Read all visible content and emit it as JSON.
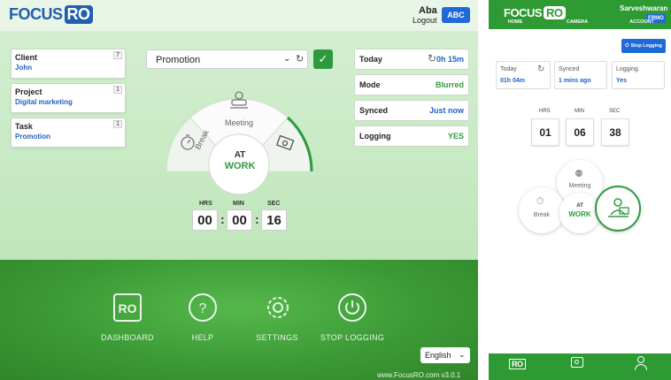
{
  "desktop": {
    "logo": {
      "text": "FOCUS",
      "suffix": "RO"
    },
    "header": {
      "user": "Aba",
      "logout": "Logout",
      "account_button": "ABC"
    },
    "fields": [
      {
        "label": "Client",
        "value": "John",
        "count": "7"
      },
      {
        "label": "Project",
        "value": "Digital marketing",
        "count": "1"
      },
      {
        "label": "Task",
        "value": "Promotion",
        "count": "1"
      }
    ],
    "activity_select": {
      "value": "Promotion"
    },
    "stats": [
      {
        "label": "Today",
        "value": "0h 15m"
      },
      {
        "label": "Mode",
        "value": "Blurred"
      },
      {
        "label": "Synced",
        "value": "Just now"
      },
      {
        "label": "Logging",
        "value": "YES"
      }
    ],
    "wheel": {
      "meeting": "Meeting",
      "break": "Break",
      "status_top": "AT",
      "status_bottom": "WORK"
    },
    "timer": {
      "hrs_label": "HRS",
      "min_label": "MIN",
      "sec_label": "SEC",
      "hrs": "00",
      "min": "00",
      "sec": "16"
    },
    "nav": [
      {
        "label": "DASHBOARD",
        "icon": "ro-logo-icon"
      },
      {
        "label": "HELP",
        "icon": "question-icon"
      },
      {
        "label": "SETTINGS",
        "icon": "gear-icon"
      },
      {
        "label": "STOP LOGGING",
        "icon": "power-icon"
      }
    ],
    "language": "English",
    "footer": "www.FocusRO.com v3.0.1"
  },
  "mobile": {
    "logo": {
      "text": "FOCUS",
      "suffix": "RO"
    },
    "user": "Sarveshwaran",
    "badge": "FRMO",
    "stop_button": "Stop Logging",
    "cards": [
      {
        "label": "Today",
        "value": "01h 04m"
      },
      {
        "label": "Synced",
        "value": "1 mins ago"
      },
      {
        "label": "Logging",
        "value": "Yes"
      }
    ],
    "timer": {
      "hrs_label": "HRS",
      "min_label": "MIN",
      "sec_label": "SEC",
      "hrs": "01",
      "min": "06",
      "sec": "38"
    },
    "modes": {
      "meeting": "Meeting",
      "break": "Break",
      "at": "AT",
      "work": "WORK"
    },
    "nav": [
      {
        "label": "HOME",
        "icon": "ro-logo-icon"
      },
      {
        "label": "CAMERA",
        "icon": "camera-icon"
      },
      {
        "label": "ACCOUNT",
        "icon": "user-icon"
      }
    ]
  },
  "colors": {
    "brand_green": "#2d9a34",
    "brand_blue": "#1f6ad8",
    "link_blue": "#1f62c7"
  }
}
